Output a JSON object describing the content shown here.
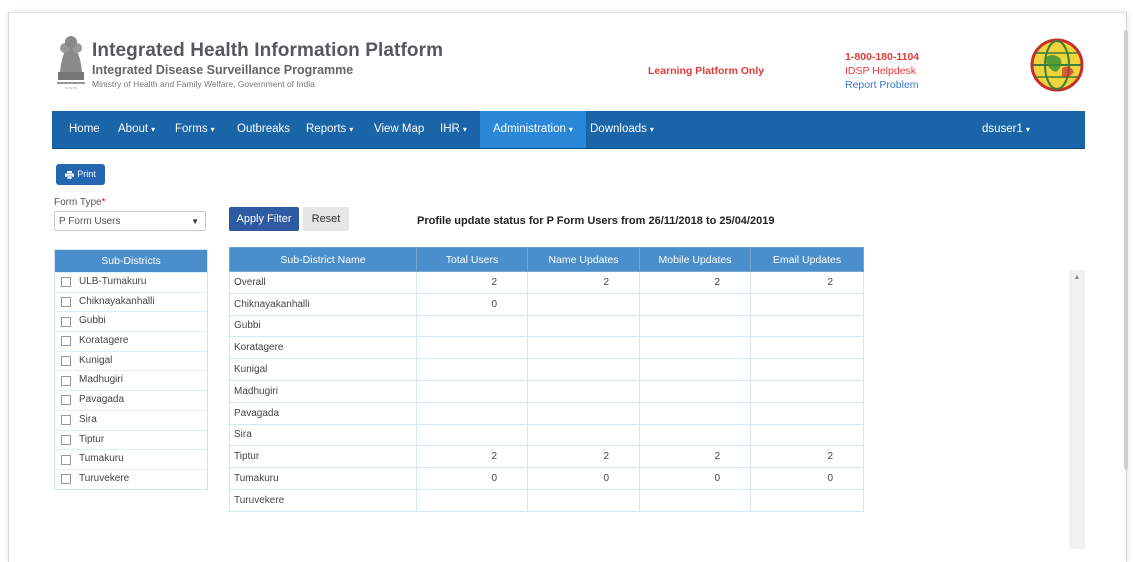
{
  "header": {
    "title": "Integrated Health Information Platform",
    "subtitle": "Integrated Disease Surveillance Programme",
    "ministry": "Ministry of Health and Family Welfare, Government of India",
    "learning_notice": "Learning Platform Only",
    "helpline": "1-800-180-1104",
    "helpdesk": "IDSP Helpdesk",
    "report_problem": "Report Problem"
  },
  "nav": {
    "home": "Home",
    "about": "About",
    "forms": "Forms",
    "outbreaks": "Outbreaks",
    "reports": "Reports",
    "view_map": "View Map",
    "ihr": "IHR",
    "administration": "Administration",
    "downloads": "Downloads",
    "user": "dsuser1"
  },
  "toolbar": {
    "print": "Print",
    "form_type_label": "Form Type",
    "form_type_required": "*",
    "form_type_value": "P Form Users",
    "apply_filter": "Apply Filter",
    "reset": "Reset"
  },
  "report_title": "Profile update status for P Form Users from 26/11/2018 to 25/04/2019",
  "subdistrict_panel": {
    "heading": "Sub-Districts",
    "items": [
      "ULB-Tumakuru",
      "Chiknayakanhalli",
      "Gubbi",
      "Koratagere",
      "Kunigal",
      "Madhugiri",
      "Pavagada",
      "Sira",
      "Tiptur",
      "Tumakuru",
      "Turuvekere"
    ]
  },
  "table": {
    "columns": [
      "Sub-District Name",
      "Total Users",
      "Name Updates",
      "Mobile Updates",
      "Email Updates"
    ],
    "rows": [
      [
        "Overall",
        "2",
        "2",
        "2",
        "2"
      ],
      [
        "Chiknayakanhalli",
        "0",
        "",
        "",
        ""
      ],
      [
        "Gubbi",
        "",
        "",
        "",
        ""
      ],
      [
        "Koratagere",
        "",
        "",
        "",
        ""
      ],
      [
        "Kunigal",
        "",
        "",
        "",
        ""
      ],
      [
        "Madhugiri",
        "",
        "",
        "",
        ""
      ],
      [
        "Pavagada",
        "",
        "",
        "",
        ""
      ],
      [
        "Sira",
        "",
        "",
        "",
        ""
      ],
      [
        "Tiptur",
        "2",
        "2",
        "2",
        "2"
      ],
      [
        "Tumakuru",
        "0",
        "0",
        "0",
        "0"
      ],
      [
        "Turuvekere",
        "",
        "",
        "",
        ""
      ]
    ]
  },
  "colors": {
    "navbar": "#1a64a8",
    "nav_active": "#2b88d8",
    "table_header": "#4a8fcb",
    "alert_red": "#e43a3a",
    "link_blue": "#3a78c9"
  }
}
